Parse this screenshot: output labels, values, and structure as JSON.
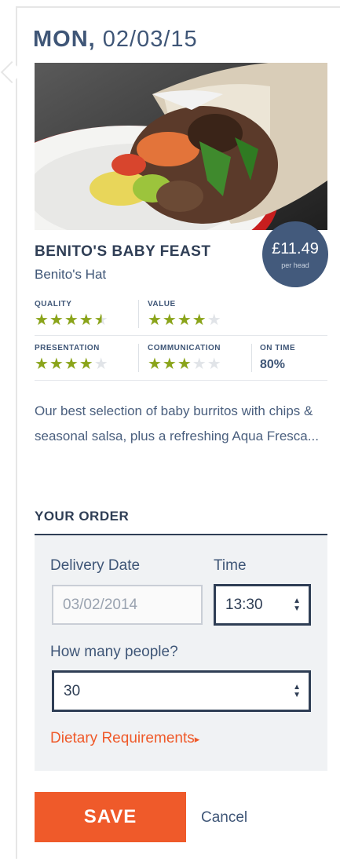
{
  "header": {
    "day": "MON,",
    "date": "02/03/15"
  },
  "product": {
    "title": "BENITO'S BABY FEAST",
    "vendor": "Benito's Hat",
    "price": "£11.49",
    "price_unit": "per head",
    "description": "Our best selection of baby burritos with chips & seasonal salsa, plus a refreshing Aqua Fresca..."
  },
  "ratings": {
    "quality": {
      "label": "QUALITY",
      "stars": 4.5
    },
    "value": {
      "label": "VALUE",
      "stars": 4
    },
    "presentation": {
      "label": "PRESENTATION",
      "stars": 4
    },
    "communication": {
      "label": "COMMUNICATION",
      "stars": 3
    },
    "on_time": {
      "label": "ON TIME",
      "value": "80%"
    },
    "star_color": "#8aa41a"
  },
  "order": {
    "heading": "YOUR ORDER",
    "delivery_date_label": "Delivery Date",
    "delivery_date_value": "03/02/2014",
    "time_label": "Time",
    "time_value": "13:30",
    "people_label": "How many people?",
    "people_value": "30",
    "dietary_link": "Dietary Requirements",
    "dietary_arrow": "▸"
  },
  "actions": {
    "save": "SAVE",
    "cancel": "Cancel"
  },
  "colors": {
    "accent": "#ef5a2a",
    "navy": "#2f3e55",
    "panel": "#f0f2f4"
  }
}
